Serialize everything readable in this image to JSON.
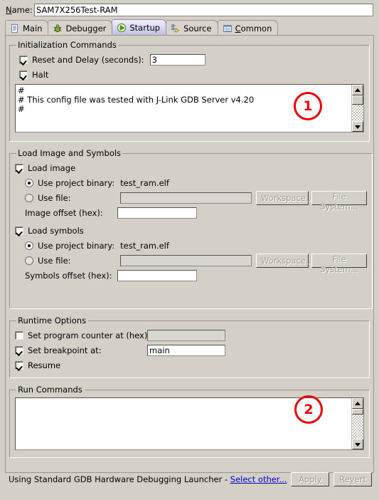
{
  "name_row": {
    "label_prefix": "N",
    "label_rest": "ame:",
    "value": "SAM7X256Test-RAM"
  },
  "tabs": [
    {
      "label": "Main",
      "icon": "document-icon",
      "selected": false,
      "mnemonic": ""
    },
    {
      "label": "Debugger",
      "icon": "bug-icon",
      "selected": false,
      "mnemonic": ""
    },
    {
      "label": "Startup",
      "icon": "run-arrow-icon",
      "selected": true,
      "mnemonic": ""
    },
    {
      "label": "Source",
      "icon": "source-lookup-icon",
      "selected": false,
      "mnemonic": ""
    },
    {
      "label": "Common",
      "icon": "common-list-icon",
      "selected": false,
      "mnemonic": "C"
    }
  ],
  "init_commands": {
    "legend": "Initialization Commands",
    "reset_delay_label": "Reset and Delay (seconds):",
    "reset_delay_checked": true,
    "reset_delay_value": "3",
    "halt_label": "Halt",
    "halt_checked": true,
    "textarea_value": "#\n# This config file was tested with J-Link GDB Server v4.20\n#"
  },
  "load_image_symbols": {
    "legend": "Load Image and Symbols",
    "load_image_label": "Load image",
    "load_image_checked": true,
    "image_project_binary_label": "Use project binary:",
    "image_project_binary_value": "test_ram.elf",
    "image_project_binary_selected": true,
    "image_use_file_label": "Use file:",
    "image_use_file_selected": false,
    "image_use_file_value": "",
    "image_workspace_button": "Workspace...",
    "image_filesystem_button": "File System...",
    "image_offset_label": "Image offset (hex):",
    "image_offset_value": "",
    "load_symbols_label": "Load symbols",
    "load_symbols_checked": true,
    "symbols_project_binary_label": "Use project binary:",
    "symbols_project_binary_value": "test_ram.elf",
    "symbols_project_binary_selected": true,
    "symbols_use_file_label": "Use file:",
    "symbols_use_file_selected": false,
    "symbols_use_file_value": "",
    "symbols_workspace_button": "Workspace...",
    "symbols_filesystem_button": "File System...",
    "symbols_offset_label": "Symbols offset (hex):",
    "symbols_offset_value": ""
  },
  "runtime_options": {
    "legend": "Runtime Options",
    "set_pc_label": "Set program counter at (hex):",
    "set_pc_checked": false,
    "set_pc_value": "",
    "set_breakpoint_label": "Set breakpoint at:",
    "set_breakpoint_checked": true,
    "set_breakpoint_value": "main",
    "resume_label": "Resume",
    "resume_checked": true
  },
  "run_commands": {
    "legend": "Run Commands",
    "textarea_value": ""
  },
  "bottom": {
    "status_text": "Using Standard GDB Hardware Debugging Launcher - ",
    "select_other_label": "Select other...",
    "apply_label_prefix": "Appl",
    "apply_label_mnemonic": "y",
    "revert_label_prefix": "Re",
    "revert_label_mnemonic": "v",
    "revert_label_suffix": "ert",
    "apply_enabled": false,
    "revert_enabled": false
  },
  "annotations": [
    {
      "number": "1"
    },
    {
      "number": "2"
    }
  ],
  "colors": {
    "dialog_bg": "#d4d0c8",
    "annotation_red": "#ee0000",
    "link_blue": "#0000c0",
    "selected_tab": "#c3c0e4"
  }
}
